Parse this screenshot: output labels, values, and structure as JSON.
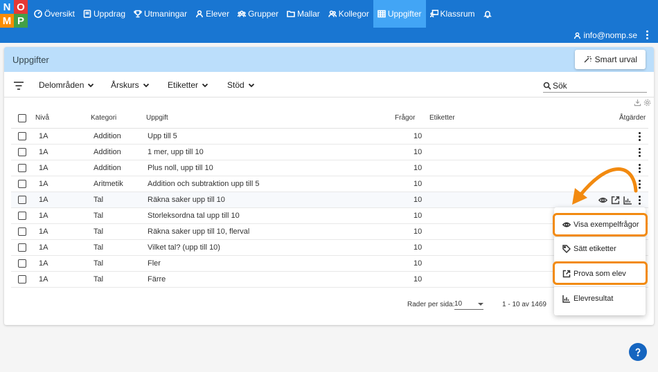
{
  "logo": {
    "letters": [
      "N",
      "O",
      "M",
      "P"
    ]
  },
  "nav": [
    {
      "label": "Översikt",
      "icon": "dashboard-icon"
    },
    {
      "label": "Uppdrag",
      "icon": "book-icon"
    },
    {
      "label": "Utmaningar",
      "icon": "trophy-icon"
    },
    {
      "label": "Elever",
      "icon": "person-icon"
    },
    {
      "label": "Grupper",
      "icon": "group-icon"
    },
    {
      "label": "Mallar",
      "icon": "folder-icon"
    },
    {
      "label": "Kollegor",
      "icon": "colleagues-icon"
    },
    {
      "label": "Uppgifter",
      "icon": "grid-icon",
      "active": true
    },
    {
      "label": "Klassrum",
      "icon": "classroom-icon"
    }
  ],
  "user": {
    "email": "info@nomp.se"
  },
  "page": {
    "title": "Uppgifter",
    "smart_button": "Smart urval"
  },
  "filters": {
    "items": [
      "Delområden",
      "Årskurs",
      "Etiketter",
      "Stöd"
    ],
    "search_placeholder": "Sök"
  },
  "table": {
    "headers": {
      "level": "Nivå",
      "category": "Kategori",
      "task": "Uppgift",
      "questions": "Frågor",
      "tags": "Etiketter",
      "actions": "Åtgärder"
    },
    "rows": [
      {
        "level": "1A",
        "category": "Addition",
        "task": "Upp till 5",
        "questions": "10"
      },
      {
        "level": "1A",
        "category": "Addition",
        "task": "1 mer, upp till 10",
        "questions": "10"
      },
      {
        "level": "1A",
        "category": "Addition",
        "task": "Plus noll, upp till 10",
        "questions": "10"
      },
      {
        "level": "1A",
        "category": "Aritmetik",
        "task": "Addition och subtraktion upp till 5",
        "questions": "10"
      },
      {
        "level": "1A",
        "category": "Tal",
        "task": "Räkna saker upp till 10",
        "questions": "10"
      },
      {
        "level": "1A",
        "category": "Tal",
        "task": "Storleksordna tal upp till 10",
        "questions": "10"
      },
      {
        "level": "1A",
        "category": "Tal",
        "task": "Räkna saker upp till 10, flerval",
        "questions": "10"
      },
      {
        "level": "1A",
        "category": "Tal",
        "task": "Vilket tal? (upp till 10)",
        "questions": "10"
      },
      {
        "level": "1A",
        "category": "Tal",
        "task": "Fler",
        "questions": "10"
      },
      {
        "level": "1A",
        "category": "Tal",
        "task": "Färre",
        "questions": "10"
      }
    ]
  },
  "pagination": {
    "rows_per_page_label": "Rader per sida:",
    "rows_per_page": "10",
    "range": "1 - 10 av 1469"
  },
  "menu": {
    "items": [
      {
        "label": "Visa exempelfrågor",
        "icon": "eye-icon"
      },
      {
        "label": "Sätt etiketter",
        "icon": "tag-icon"
      },
      {
        "label": "Prova som elev",
        "icon": "external-link-icon"
      },
      {
        "label": "Elevresultat",
        "icon": "bar-chart-icon"
      }
    ]
  },
  "colors": {
    "primary": "#1976d2",
    "active_tab": "#42a5f5",
    "header_bg": "#bbdefb",
    "highlight": "#f28a10"
  }
}
